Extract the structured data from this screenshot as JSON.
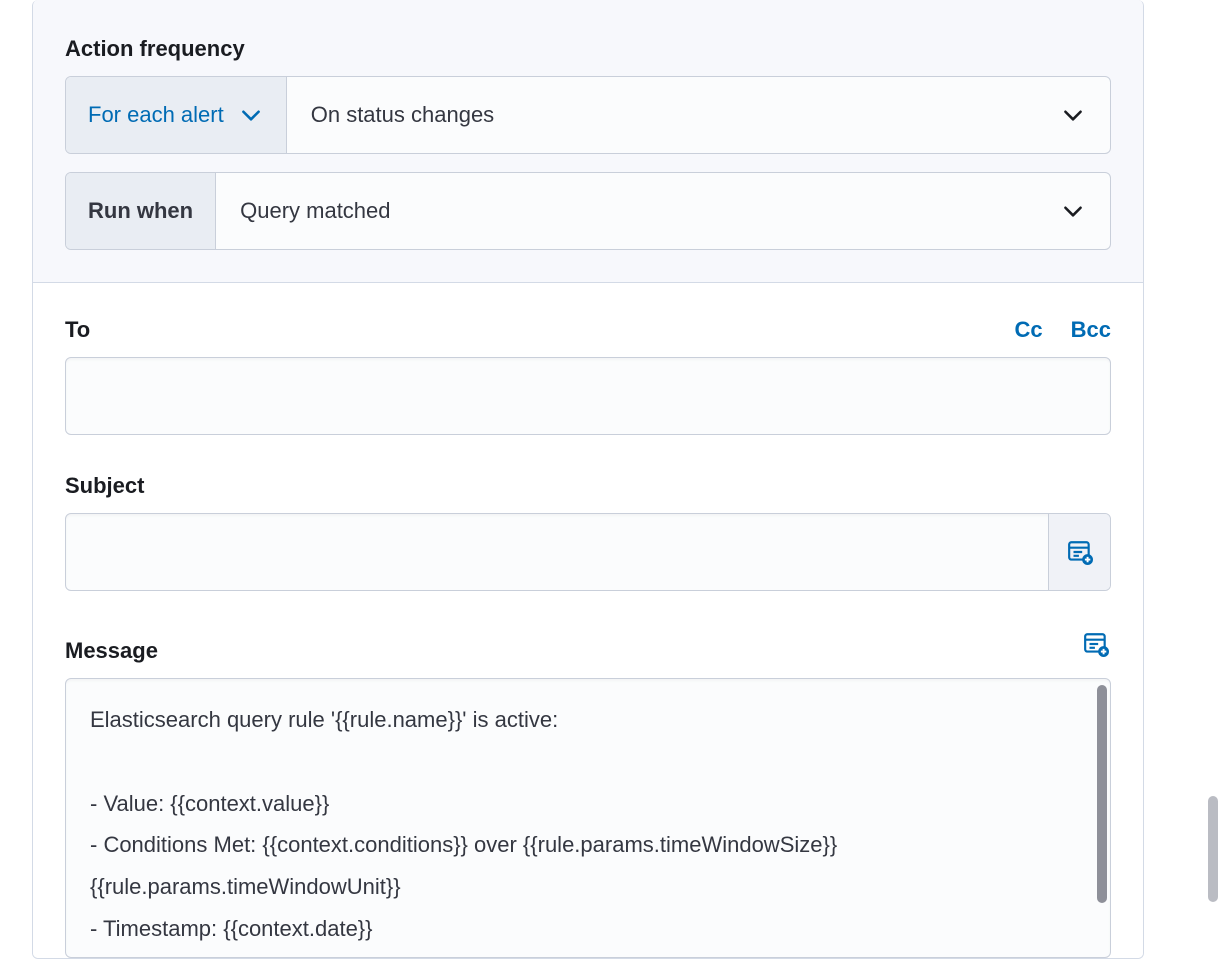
{
  "action_frequency": {
    "heading": "Action frequency",
    "scope_label": "For each alert",
    "trigger_value": "On status changes",
    "run_when_label": "Run when",
    "run_when_value": "Query matched"
  },
  "to": {
    "label": "To",
    "cc": "Cc",
    "bcc": "Bcc",
    "value": ""
  },
  "subject": {
    "label": "Subject",
    "value": ""
  },
  "message": {
    "label": "Message",
    "value": "Elasticsearch query rule '{{rule.name}}' is active:\n\n- Value: {{context.value}}\n- Conditions Met: {{context.conditions}} over {{rule.params.timeWindowSize}}{{rule.params.timeWindowUnit}}\n- Timestamp: {{context.date}}"
  },
  "icons": {
    "insert_var": "add-variable-icon"
  }
}
